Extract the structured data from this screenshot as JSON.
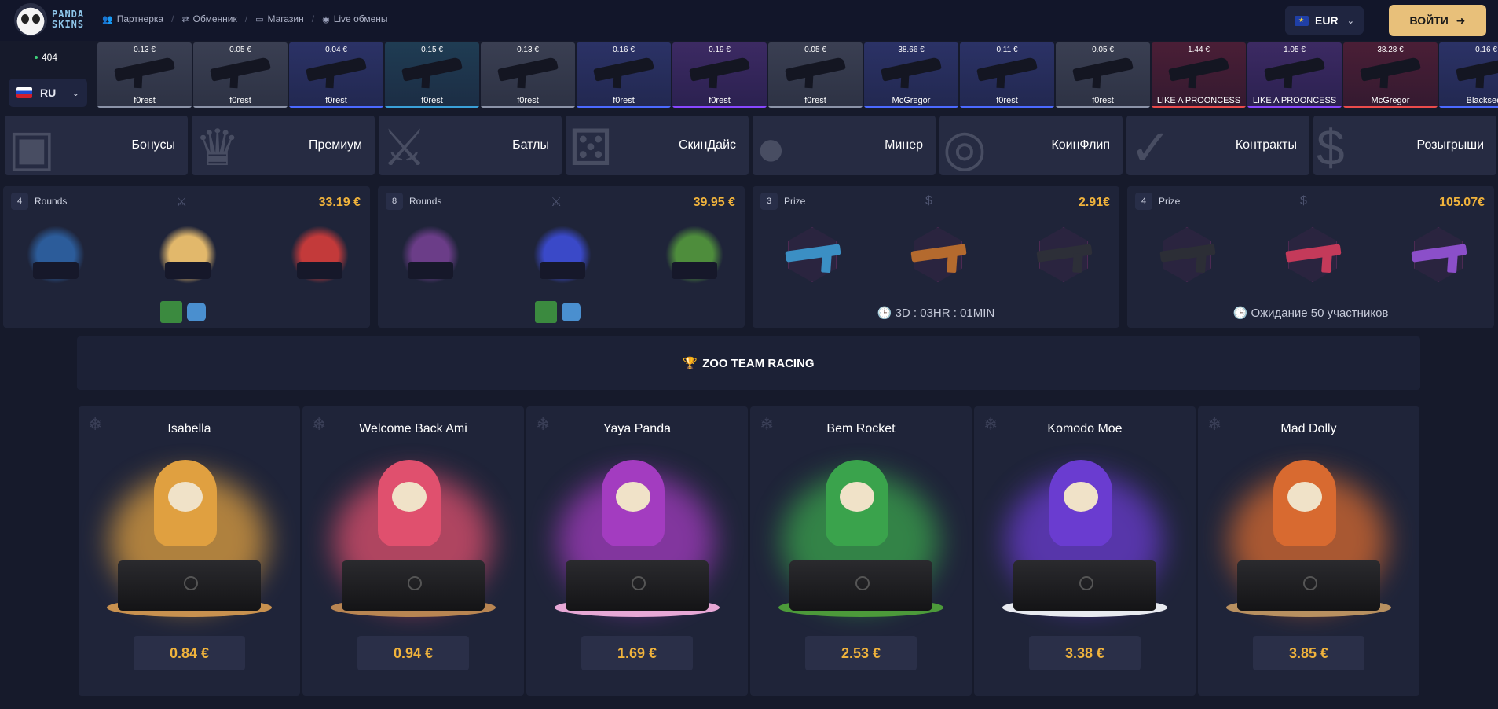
{
  "header": {
    "logo_text_line1": "PANDA",
    "logo_text_line2": "SKINS",
    "nav": [
      {
        "label": "Партнерка",
        "icon": "users-icon"
      },
      {
        "label": "Обменник",
        "icon": "exchange-icon"
      },
      {
        "label": "Магазин",
        "icon": "store-icon"
      },
      {
        "label": "Live обмены",
        "icon": "live-icon"
      }
    ],
    "currency": "EUR",
    "login_label": "ВОЙТИ"
  },
  "sidebar": {
    "online_count": "404",
    "language": "RU"
  },
  "live_drops": [
    {
      "price": "0.13 €",
      "name": "f0rest",
      "rarity": "grey"
    },
    {
      "price": "0.05 €",
      "name": "f0rest",
      "rarity": "grey"
    },
    {
      "price": "0.04 €",
      "name": "f0rest",
      "rarity": "blue"
    },
    {
      "price": "0.15 €",
      "name": "f0rest",
      "rarity": "teal"
    },
    {
      "price": "0.13 €",
      "name": "f0rest",
      "rarity": "grey"
    },
    {
      "price": "0.16 €",
      "name": "f0rest",
      "rarity": "blue"
    },
    {
      "price": "0.19 €",
      "name": "f0rest",
      "rarity": "purple"
    },
    {
      "price": "0.05 €",
      "name": "f0rest",
      "rarity": "grey"
    },
    {
      "price": "38.66 €",
      "name": "McGregor",
      "rarity": "blue"
    },
    {
      "price": "0.11 €",
      "name": "f0rest",
      "rarity": "blue"
    },
    {
      "price": "0.05 €",
      "name": "f0rest",
      "rarity": "grey"
    },
    {
      "price": "1.44 €",
      "name": "LIKE A PROONCESS",
      "rarity": "red"
    },
    {
      "price": "1.05 €",
      "name": "LIKE A PROONCESS",
      "rarity": "purple"
    },
    {
      "price": "38.28 €",
      "name": "McGregor",
      "rarity": "red"
    },
    {
      "price": "0.16 €",
      "name": "Blackseeb",
      "rarity": "blue"
    }
  ],
  "modes": [
    {
      "label": "Бонусы",
      "icon": "gift-icon"
    },
    {
      "label": "Премиум",
      "icon": "crown-icon"
    },
    {
      "label": "Батлы",
      "icon": "swords-icon"
    },
    {
      "label": "СкинДайс",
      "icon": "dice-icon"
    },
    {
      "label": "Минер",
      "icon": "bomb-icon"
    },
    {
      "label": "КоинФлип",
      "icon": "coin-icon"
    },
    {
      "label": "Контракты",
      "icon": "contract-icon"
    },
    {
      "label": "Розыгрыши",
      "icon": "dollar-icon"
    }
  ],
  "battles": [
    {
      "count": "4",
      "label": "Rounds",
      "price": "33.19 €",
      "footer": "",
      "type": "cases"
    },
    {
      "count": "8",
      "label": "Rounds",
      "price": "39.95 €",
      "footer": "",
      "type": "cases"
    },
    {
      "count": "3",
      "label": "Prize",
      "price": "2.91€",
      "footer": "3D : 03HR : 01MIN",
      "type": "weapons"
    },
    {
      "count": "4",
      "label": "Prize",
      "price": "105.07€",
      "footer": "Ожидание 50 участников",
      "type": "weapons"
    }
  ],
  "racing_title": "ZOO TEAM RACING",
  "cases": [
    {
      "name": "Isabella",
      "price": "0.84 €",
      "accent": "#e0a040",
      "ground": "#c8914f"
    },
    {
      "name": "Welcome Back Ami",
      "price": "0.94 €",
      "accent": "#e0506e",
      "ground": "#b98552"
    },
    {
      "name": "Yaya Panda",
      "price": "1.69 €",
      "accent": "#a33cc0",
      "ground": "#e7a8d6"
    },
    {
      "name": "Bem Rocket",
      "price": "2.53 €",
      "accent": "#3aa34c",
      "ground": "#4c9a3a"
    },
    {
      "name": "Komodo Moe",
      "price": "3.38 €",
      "accent": "#6a3cd0",
      "ground": "#e8eaf0"
    },
    {
      "name": "Mad Dolly",
      "price": "3.85 €",
      "accent": "#d86a30",
      "ground": "#b89060"
    }
  ],
  "colors": {
    "background": "#161a2b",
    "gold_price": "#f0b33c",
    "login_button": "#e8c07a"
  }
}
